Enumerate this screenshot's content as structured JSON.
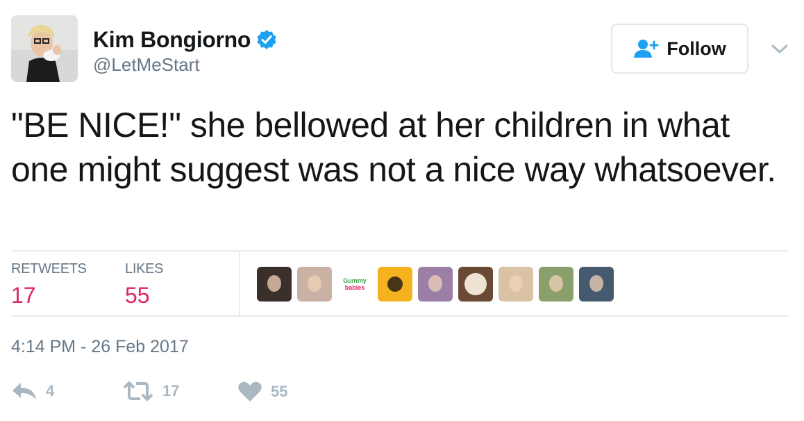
{
  "user": {
    "display_name": "Kim Bongiorno",
    "screen_name": "@LetMeStart",
    "verified_icon": "verified-badge-icon",
    "avatar_icon": "avatar"
  },
  "follow_button": {
    "label": "Follow",
    "icon": "add-user-icon"
  },
  "menu": {
    "icon": "chevron-down-icon"
  },
  "tweet": {
    "text": "\"BE NICE!\" she bellowed at her children in what one might suggest was not a nice way whatsoever."
  },
  "stats": {
    "retweets_label": "RETWEETS",
    "retweets_value": "17",
    "likes_label": "LIKES",
    "likes_value": "55"
  },
  "likers": [
    {
      "name": "liker-1",
      "color": "#3a2f2a"
    },
    {
      "name": "liker-2",
      "color": "#c9b2a3"
    },
    {
      "name": "liker-gummy-babies",
      "logo": [
        "Gummy",
        "babies"
      ],
      "color": "#ffffff"
    },
    {
      "name": "liker-4",
      "color": "#f5b21f"
    },
    {
      "name": "liker-5",
      "color": "#9b7fa6"
    },
    {
      "name": "liker-6",
      "color": "#6b4a35"
    },
    {
      "name": "liker-7",
      "color": "#d9c3a4"
    },
    {
      "name": "liker-8",
      "color": "#8aa06c"
    },
    {
      "name": "liker-9",
      "color": "#455a6e"
    }
  ],
  "timestamp": "4:14 PM - 26 Feb 2017",
  "actions": {
    "reply": {
      "icon": "reply-icon",
      "count": "4"
    },
    "retweet": {
      "icon": "retweet-icon",
      "count": "17"
    },
    "like": {
      "icon": "heart-icon",
      "count": "55"
    }
  },
  "colors": {
    "text": "#14171a",
    "secondary": "#657786",
    "accent_like": "#e0245e",
    "verified": "#1da1f2",
    "action_gray": "#aab8c2",
    "divider": "#e6ecf0"
  }
}
